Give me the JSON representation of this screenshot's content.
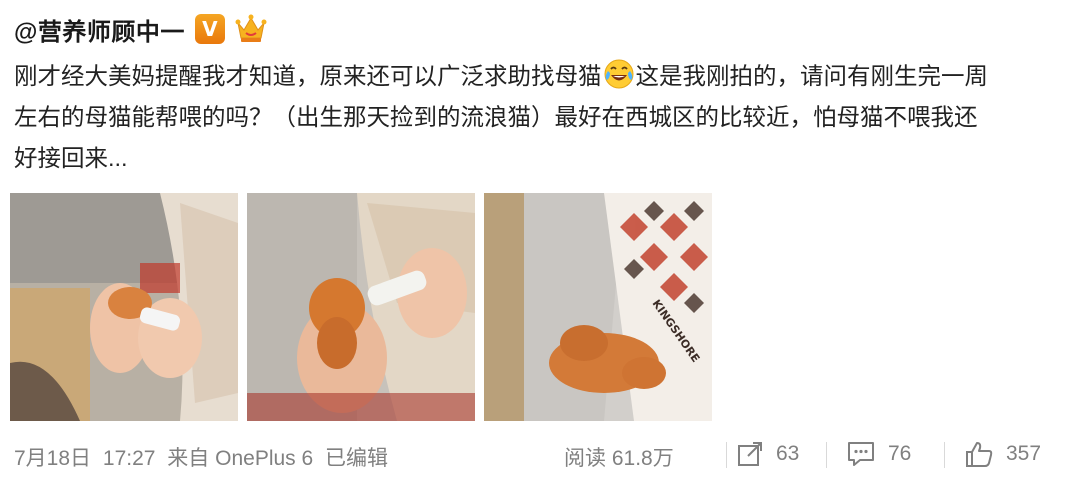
{
  "post": {
    "username": "@营养师顾中一",
    "verified_badge": "V",
    "content_lines": [
      "刚才经大美妈提醒我才知道，原来还可以广泛求助找母猫",
      "这是我刚拍的，请问有刚生完一周",
      "左右的母猫能帮喂的吗？（出生那天捡到的流浪猫）最好在西城区的比较近，怕母猫不喂我还",
      "好接回来..."
    ],
    "photo_texts": [
      "KINGSHORE"
    ],
    "footer": {
      "date": "7月18日",
      "time": "17:27",
      "source": "来自 OnePlus 6",
      "edited": "已编辑",
      "views": "阅读 61.8万",
      "reposts": "63",
      "comments": "76",
      "likes": "357"
    }
  },
  "icons": [
    "vip-v-icon",
    "crown-member-icon",
    "laughing-tears-emoji-icon",
    "repost-icon",
    "comment-icon",
    "like-icon"
  ],
  "colors": {
    "text": "#222222",
    "meta": "#808080",
    "badge": "#f39321",
    "separator": "#d9d9d9"
  }
}
